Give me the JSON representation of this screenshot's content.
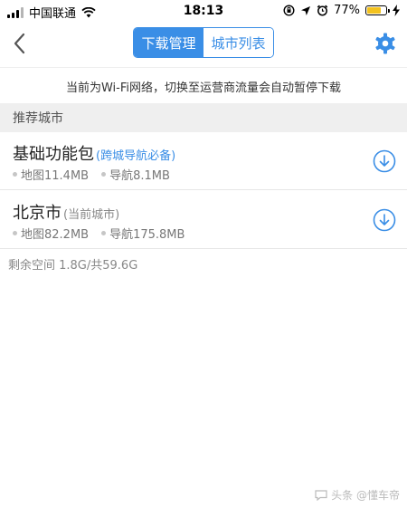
{
  "status_bar": {
    "carrier": "中国联通",
    "time": "18:13",
    "battery_percent": "77%",
    "battery_level": 0.77
  },
  "nav": {
    "tabs": [
      {
        "label": "下载管理",
        "active": true
      },
      {
        "label": "城市列表",
        "active": false
      }
    ]
  },
  "notice": "当前为Wi-Fi网络，切换至运营商流量会自动暂停下载",
  "section_title": "推荐城市",
  "cities": [
    {
      "name": "基础功能包",
      "tag": "(跨城导航必备)",
      "map_size": "地图11.4MB",
      "nav_size": "导航8.1MB"
    },
    {
      "name": "北京市",
      "tag": "(当前城市)",
      "map_size": "地图82.2MB",
      "nav_size": "导航175.8MB"
    }
  ],
  "storage": "剩余空间 1.8G/共59.6G",
  "watermark": "头条 @懂车帝",
  "colors": {
    "accent": "#3a8ee6",
    "battery": "#f3c21e"
  }
}
